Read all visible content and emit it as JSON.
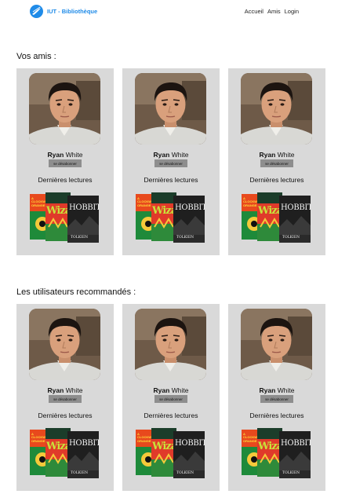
{
  "nav": {
    "brand": "IUT - Bibliothèque",
    "links": [
      "Accueil",
      "Amis",
      "Login"
    ]
  },
  "friends": {
    "title": "Vos amis :",
    "cards": [
      {
        "first_name": "Ryan",
        "last_name": "White",
        "button": "se désabonner",
        "reads_label": "Dernières lectures"
      },
      {
        "first_name": "Ryan",
        "last_name": "White",
        "button": "se désabonner",
        "reads_label": "Dernières lectures"
      },
      {
        "first_name": "Ryan",
        "last_name": "White",
        "button": "se désabonner",
        "reads_label": "Dernières lectures"
      }
    ]
  },
  "recommended": {
    "title": "Les utilisateurs recommandés :",
    "cards": [
      {
        "first_name": "Ryan",
        "last_name": "White",
        "button": "se désabonner",
        "reads_label": "Dernières lectures"
      },
      {
        "first_name": "Ryan",
        "last_name": "White",
        "button": "se désabonner",
        "reads_label": "Dernières lectures"
      },
      {
        "first_name": "Ryan",
        "last_name": "White",
        "button": "se désabonner",
        "reads_label": "Dernières lectures"
      }
    ]
  },
  "book_covers": {
    "clockwork": "A CLOCKWORK ORANGE",
    "wizard": "Wizard",
    "hobbit": "HOBBIT",
    "author": "TOLKIEN"
  },
  "colors": {
    "brand": "#1f8be8",
    "card_bg": "#d9d9d9",
    "button_bg": "#8e8e8e"
  }
}
